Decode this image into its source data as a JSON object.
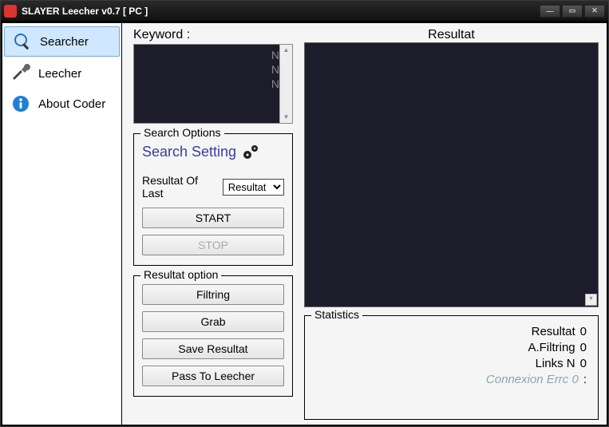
{
  "title": "SLAYER Leecher v0.7 [ PC ]",
  "sidebar": {
    "items": [
      {
        "label": "Searcher"
      },
      {
        "label": "Leecher"
      },
      {
        "label": "About Coder"
      }
    ]
  },
  "keyword_label": "Keyword :",
  "ghost_lines": [
    "N",
    "N",
    "N"
  ],
  "search_options": {
    "group_title": "Search Options",
    "setting_label": "Search Setting",
    "resultat_of_last_label": "Resultat Of Last",
    "combo_selected": "Resultat",
    "start_label": "START",
    "stop_label": "STOP"
  },
  "resultat_option": {
    "group_title": "Resultat option",
    "filtring": "Filtring",
    "grab": "Grab",
    "save": "Save Resultat",
    "pass": "Pass To Leecher"
  },
  "resultat_label": "Resultat",
  "statistics": {
    "group_title": "Statistics",
    "rows": [
      {
        "k": "Resultat",
        "v": "0"
      },
      {
        "k": "A.Filtring",
        "v": "0"
      },
      {
        "k": "Links N",
        "v": "0"
      }
    ],
    "err_k": "Connexion Errc 0",
    "err_v": ":"
  }
}
